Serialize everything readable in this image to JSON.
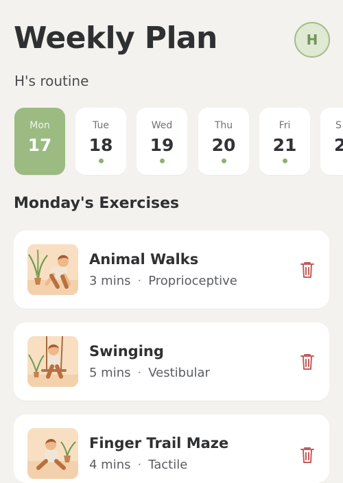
{
  "header": {
    "title": "Weekly Plan",
    "avatar_initial": "H",
    "subtitle": "H's routine"
  },
  "days": [
    {
      "name": "Mon",
      "number": "17",
      "selected": true
    },
    {
      "name": "Tue",
      "number": "18",
      "has_dot": true
    },
    {
      "name": "Wed",
      "number": "19",
      "has_dot": true
    },
    {
      "name": "Thu",
      "number": "20",
      "has_dot": true
    },
    {
      "name": "Fri",
      "number": "21",
      "has_dot": true
    },
    {
      "name": "S",
      "number": "2"
    }
  ],
  "section": {
    "title": "Monday's Exercises"
  },
  "exercises": [
    {
      "name": "Animal Walks",
      "duration": "3 mins",
      "type": "Proprioceptive",
      "icon": "crawling-child-plant-illustration"
    },
    {
      "name": "Swinging",
      "duration": "5 mins",
      "type": "Vestibular",
      "icon": "child-swing-plant-illustration"
    },
    {
      "name": "Finger Trail Maze",
      "duration": "4 mins",
      "type": "Tactile",
      "icon": "child-sitting-plant-illustration"
    }
  ],
  "colors": {
    "background": "#f3f2ee",
    "accent_green": "#9bbb82",
    "trash_red": "#c45a5a"
  }
}
